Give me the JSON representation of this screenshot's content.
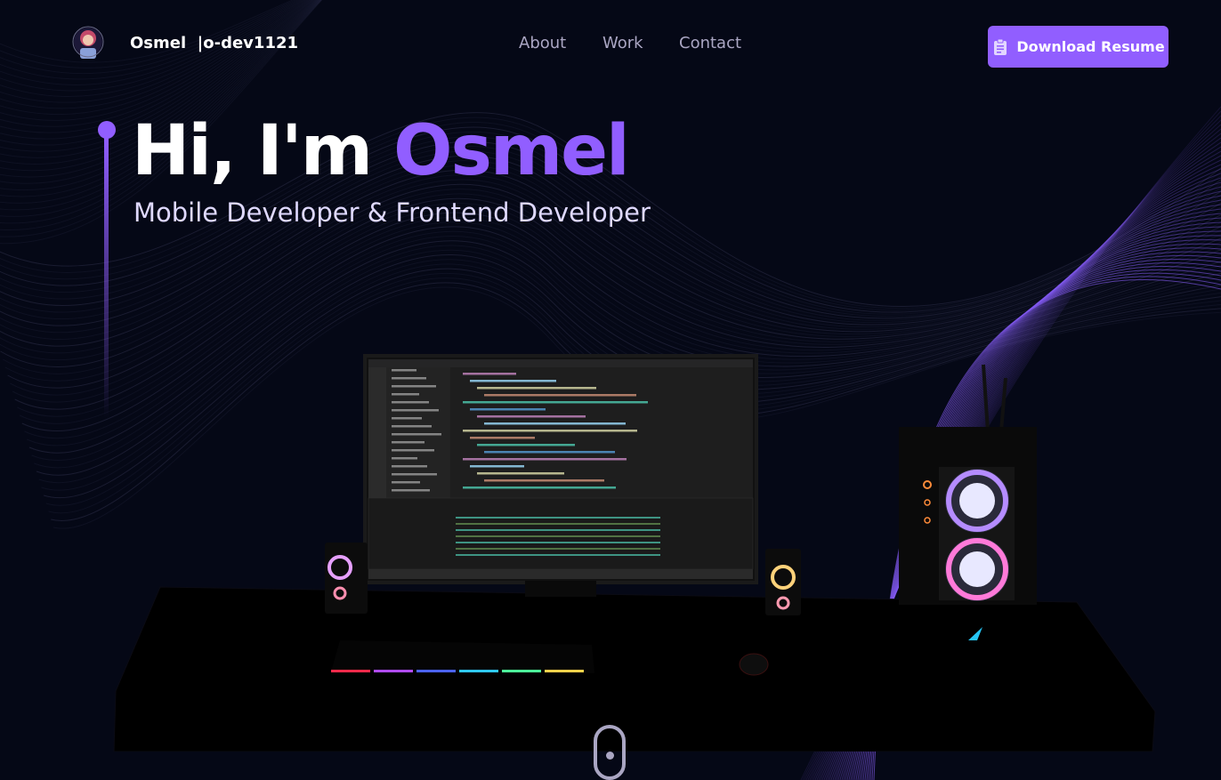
{
  "nav": {
    "brand": "Osmel  |o-dev1121",
    "links": [
      "About",
      "Work",
      "Contact"
    ],
    "resume_label": "Download Resume",
    "logo_icon": "avatar-logo-icon",
    "resume_icon": "clipboard-icon"
  },
  "hero": {
    "greeting": "Hi, I'm ",
    "name": "Osmel",
    "subtitle": "Mobile Developer & Frontend Developer"
  },
  "colors": {
    "background": "#050816",
    "accent": "#915eff",
    "secondary_text": "#aaa6c3"
  },
  "scroll_indicator_icon": "mouse-scroll-icon"
}
